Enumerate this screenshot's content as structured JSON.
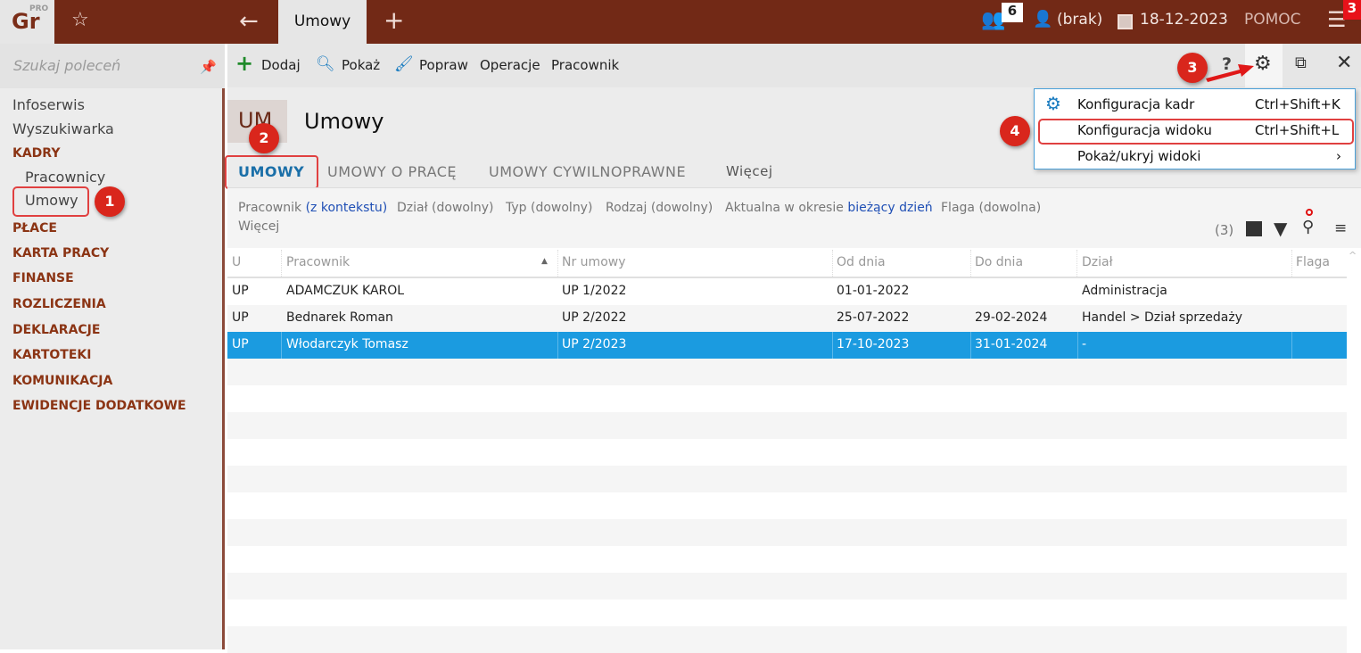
{
  "topbar": {
    "logo": "Gr",
    "logo_sup": "PRO",
    "tab": "Umowy",
    "notif_count": "6",
    "user": "(brak)",
    "date": "18-12-2023",
    "help": "POMOC",
    "menu_badge": "3"
  },
  "sidebar": {
    "search_placeholder": "Szukaj poleceń",
    "items": [
      {
        "label": "Infoserwis",
        "type": "item"
      },
      {
        "label": "Wyszukiwarka",
        "type": "item"
      },
      {
        "label": "KADRY",
        "type": "cat"
      },
      {
        "label": "Pracownicy",
        "type": "sub"
      },
      {
        "label": "Umowy",
        "type": "sub"
      },
      {
        "label": "PŁACE",
        "type": "cat"
      },
      {
        "label": "KARTA PRACY",
        "type": "cat"
      },
      {
        "label": "FINANSE",
        "type": "cat"
      },
      {
        "label": "ROZLICZENIA",
        "type": "cat"
      },
      {
        "label": "DEKLARACJE",
        "type": "cat"
      },
      {
        "label": "KARTOTEKI",
        "type": "cat"
      },
      {
        "label": "KOMUNIKACJA",
        "type": "cat"
      },
      {
        "label": "EWIDENCJE DODATKOWE",
        "type": "cat"
      }
    ]
  },
  "toolbar": {
    "add": "Dodaj",
    "show": "Pokaż",
    "edit": "Popraw",
    "operations": "Operacje",
    "employee": "Pracownik",
    "help": "?"
  },
  "header": {
    "badge": "UM",
    "title": "Umowy"
  },
  "tabs": [
    "UMOWY",
    "UMOWY O PRACĘ",
    "UMOWY CYWILNOPRAWNE",
    "Więcej"
  ],
  "filters": {
    "employee": "Pracownik",
    "employee_val": "(z kontekstu)",
    "dept": "Dział (dowolny)",
    "type": "Typ (dowolny)",
    "kind": "Rodzaj (dowolny)",
    "period": "Aktualna w okresie",
    "period_val": "bieżący dzień",
    "flag": "Flaga (dowolna)",
    "more": "Więcej",
    "count": "(3)"
  },
  "table": {
    "columns": [
      "U",
      "Pracownik",
      "Nr umowy",
      "Od dnia",
      "Do dnia",
      "Dział",
      "Flaga"
    ],
    "rows": [
      [
        "UP",
        "ADAMCZUK KAROL",
        "UP 1/2022",
        "01-01-2022",
        "",
        "Administracja",
        ""
      ],
      [
        "UP",
        "Bednarek Roman",
        "UP 2/2022",
        "25-07-2022",
        "29-02-2024",
        "Handel > Dział sprzedaży",
        ""
      ],
      [
        "UP",
        "Włodarczyk Tomasz",
        "UP 2/2023",
        "17-10-2023",
        "31-01-2024",
        "-",
        ""
      ]
    ]
  },
  "menu": {
    "items": [
      {
        "label": "Konfiguracja kadr",
        "shortcut": "Ctrl+Shift+K"
      },
      {
        "label": "Konfiguracja widoku",
        "shortcut": "Ctrl+Shift+L"
      },
      {
        "label": "Pokaż/ukryj widoki",
        "shortcut": "›"
      }
    ]
  },
  "callouts": [
    "1",
    "2",
    "3",
    "4"
  ],
  "colors": {
    "brand": "#722916",
    "selection": "#1b9be0",
    "callout": "#d9261c"
  }
}
